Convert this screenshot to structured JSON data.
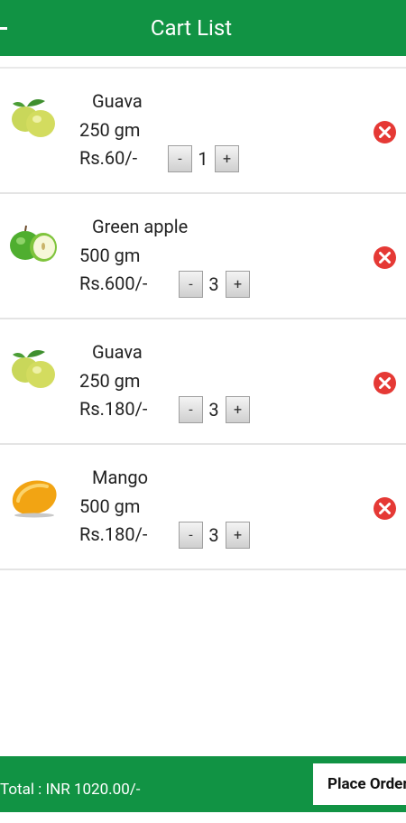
{
  "header": {
    "title": "Cart List",
    "back_label": "back"
  },
  "items": [
    {
      "name": "Guava",
      "weight": "250 gm",
      "price": "Rs.60/-",
      "qty": "1",
      "minus": "-",
      "plus": "+"
    },
    {
      "name": "Green apple",
      "weight": "500 gm",
      "price": "Rs.600/-",
      "qty": "3",
      "minus": "-",
      "plus": "+"
    },
    {
      "name": "Guava",
      "weight": "250 gm",
      "price": "Rs.180/-",
      "qty": "3",
      "minus": "-",
      "plus": "+"
    },
    {
      "name": "Mango",
      "weight": "500 gm",
      "price": "Rs.180/-",
      "qty": "3",
      "minus": "-",
      "plus": "+"
    }
  ],
  "footer": {
    "total": "Total : INR 1020.00/-",
    "place_order": "Place Order"
  },
  "colors": {
    "primary": "#119344",
    "remove": "#e53935"
  }
}
